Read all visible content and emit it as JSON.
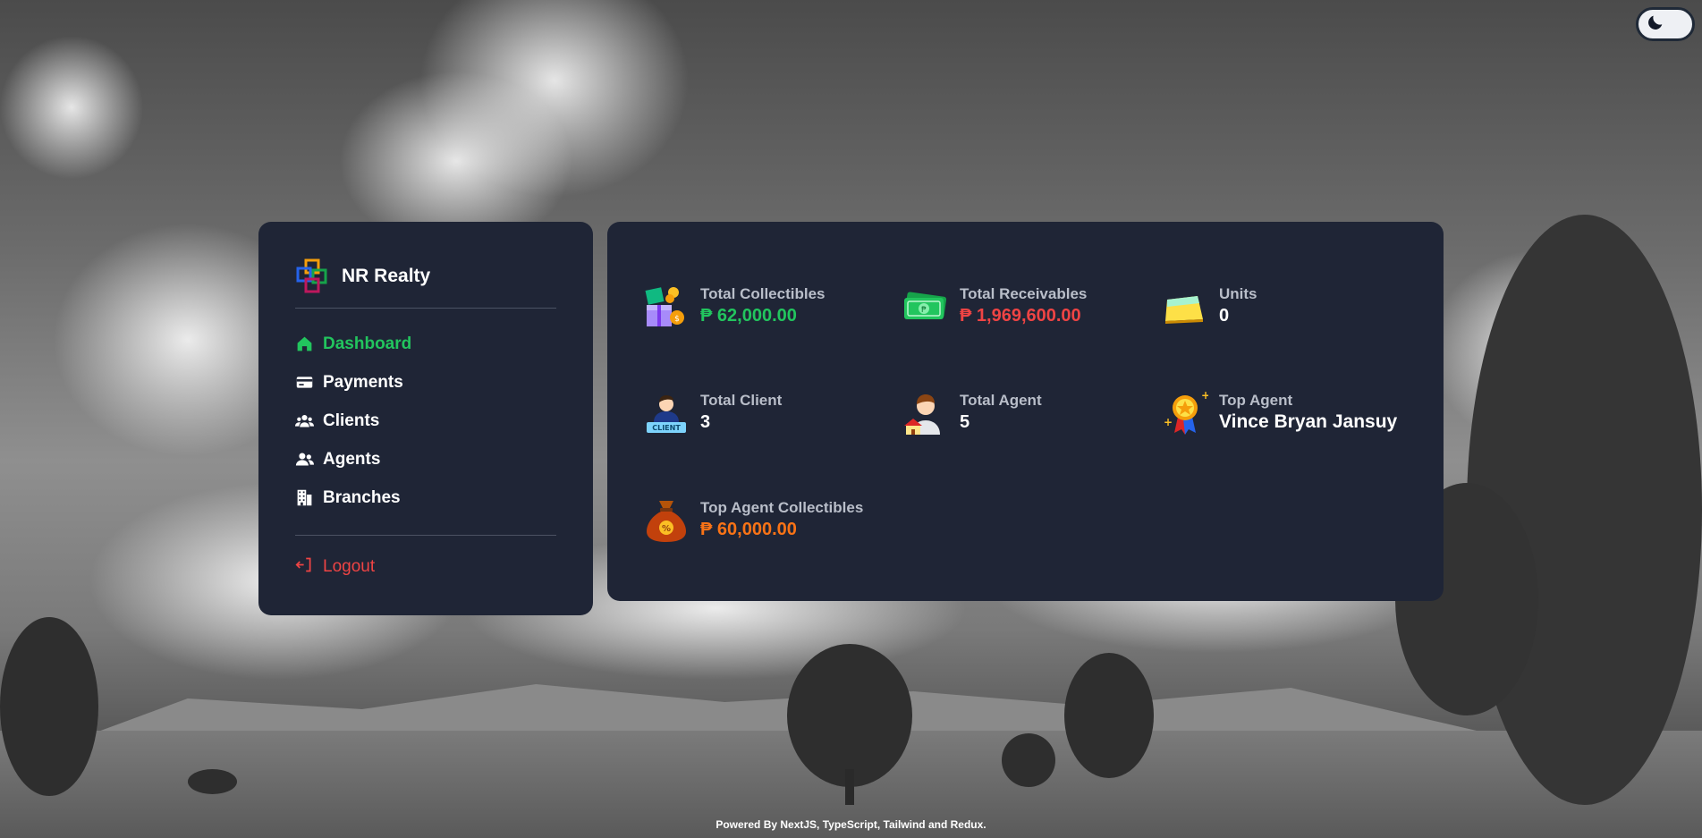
{
  "brand": {
    "name": "NR Realty"
  },
  "sidebar": {
    "items": [
      {
        "label": "Dashboard",
        "icon": "home-icon",
        "active": true
      },
      {
        "label": "Payments",
        "icon": "credit-card-icon",
        "active": false
      },
      {
        "label": "Clients",
        "icon": "users-icon",
        "active": false
      },
      {
        "label": "Agents",
        "icon": "user-group-icon",
        "active": false
      },
      {
        "label": "Branches",
        "icon": "building-icon",
        "active": false
      }
    ],
    "logout_label": "Logout"
  },
  "stats": {
    "total_collectibles": {
      "label": "Total Collectibles",
      "value": "₱ 62,000.00",
      "icon": "money-gift-icon",
      "color": "#22c55e"
    },
    "total_receivables": {
      "label": "Total Receivables",
      "value": "₱ 1,969,600.00",
      "icon": "cash-icon",
      "color": "#ef4444"
    },
    "units": {
      "label": "Units",
      "value": "0",
      "icon": "land-unit-icon",
      "color": "#ffffff"
    },
    "total_client": {
      "label": "Total Client",
      "value": "3",
      "icon": "client-icon",
      "color": "#ffffff"
    },
    "total_agent": {
      "label": "Total Agent",
      "value": "5",
      "icon": "agent-icon",
      "color": "#ffffff"
    },
    "top_agent": {
      "label": "Top Agent",
      "value": "Vince Bryan Jansuy",
      "icon": "medal-icon",
      "color": "#ffffff"
    },
    "top_agent_collectibles": {
      "label": "Top Agent Collectibles",
      "value": "₱ 60,000.00",
      "icon": "money-bag-icon",
      "color": "#f97316"
    }
  },
  "theme_toggle": {
    "icon": "moon-icon"
  },
  "footer": {
    "text": "Powered By NextJS, TypeScript, Tailwind and Redux."
  }
}
